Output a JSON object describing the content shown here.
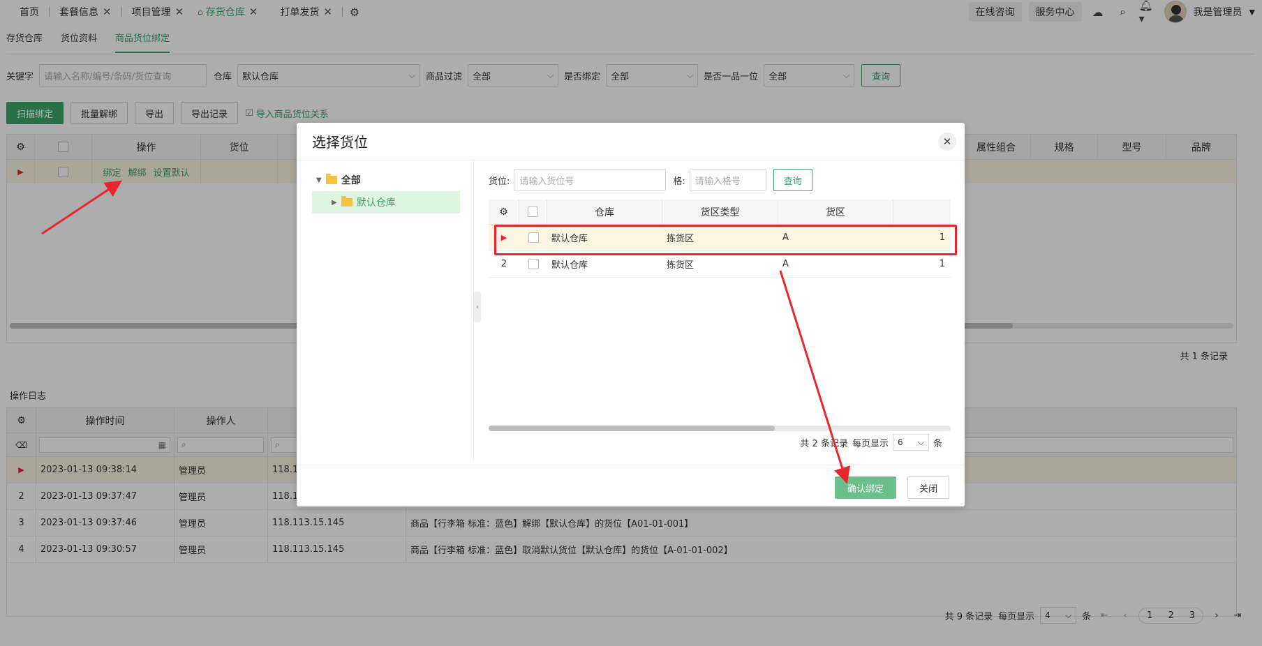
{
  "topbar": {
    "tabs": [
      {
        "label": "首页",
        "closable": false,
        "active": false
      },
      {
        "label": "套餐信息",
        "closable": true,
        "active": false
      },
      {
        "label": "项目管理",
        "closable": true,
        "active": false
      },
      {
        "label": "存货仓库",
        "closable": true,
        "active": true
      },
      {
        "label": "打单发货",
        "closable": true,
        "active": false
      }
    ],
    "online_consult": "在线咨询",
    "service_center": "服务中心",
    "user_name": "我是管理员"
  },
  "subtabs": [
    "存货仓库",
    "货位资料",
    "商品货位绑定"
  ],
  "filters": {
    "keyword_label": "关键字",
    "keyword_placeholder": "请输入名称/编号/条码/货位查询",
    "warehouse_label": "仓库",
    "warehouse_value": "默认仓库",
    "product_filter_label": "商品过滤",
    "product_filter_value": "全部",
    "bound_label": "是否绑定",
    "bound_value": "全部",
    "one_pos_label": "是否一品一位",
    "one_pos_value": "全部",
    "query_button": "查询"
  },
  "actions": {
    "scan_bind": "扫描绑定",
    "batch_unbind": "批量解绑",
    "export": "导出",
    "export_records": "导出记录",
    "import_relation": "导入商品货位关系"
  },
  "grid1": {
    "headers": {
      "operation": "操作",
      "location": "货位",
      "attr_combo": "属性组合",
      "spec": "规格",
      "model": "型号",
      "brand": "品牌"
    },
    "row_actions": [
      "绑定",
      "解绑",
      "设置默认"
    ],
    "total": "共 1 条记录"
  },
  "log": {
    "title": "操作日志",
    "headers": {
      "time": "操作时间",
      "user": "操作人"
    },
    "rows": [
      {
        "idx": "",
        "time": "2023-01-13 09:38:14",
        "user": "管理员",
        "ip": "118.11",
        "msg": ""
      },
      {
        "idx": "2",
        "time": "2023-01-13 09:37:47",
        "user": "管理员",
        "ip": "118.11",
        "msg": ""
      },
      {
        "idx": "3",
        "time": "2023-01-13 09:37:46",
        "user": "管理员",
        "ip": "118.113.15.145",
        "msg": "商品【行李箱 标准：蓝色】解绑【默认仓库】的货位【A01-01-001】"
      },
      {
        "idx": "4",
        "time": "2023-01-13 09:30:57",
        "user": "管理员",
        "ip": "118.113.15.145",
        "msg": "商品【行李箱 标准：蓝色】取消默认货位【默认仓库】的货位【A-01-01-002】"
      }
    ],
    "pager": {
      "total": "共 9 条记录",
      "per_page_label": "每页显示",
      "per_page": "4",
      "unit": "条",
      "pages": [
        "1",
        "2",
        "3"
      ]
    }
  },
  "modal": {
    "title": "选择货位",
    "tree": {
      "root": "全部",
      "child": "默认仓库"
    },
    "search": {
      "location_label": "货位:",
      "location_placeholder": "请输入货位号",
      "cell_label": "格:",
      "cell_placeholder": "请输入格号",
      "query_button": "查询"
    },
    "grid": {
      "headers": {
        "warehouse": "仓库",
        "zone_type": "货区类型",
        "zone": "货区"
      },
      "rows": [
        {
          "idx": "",
          "warehouse": "默认仓库",
          "zone_type": "拣货区",
          "zone": "A",
          "last": "1"
        },
        {
          "idx": "2",
          "warehouse": "默认仓库",
          "zone_type": "拣货区",
          "zone": "A",
          "last": "1"
        }
      ]
    },
    "pager": {
      "total": "共 2 条记录",
      "per_page_label": "每页显示",
      "per_page": "6",
      "unit": "条"
    },
    "confirm_button": "确认绑定",
    "close_button": "关闭"
  },
  "colors": {
    "accent": "#3ca66a",
    "highlight_row": "#fdf5e4",
    "annotation_red": "#e8262b"
  }
}
